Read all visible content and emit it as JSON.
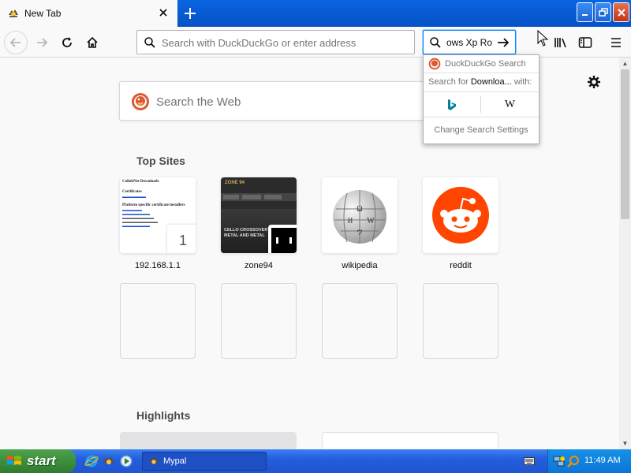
{
  "tab": {
    "title": "New Tab"
  },
  "toolbar": {
    "url_placeholder": "Search with DuckDuckGo or enter address",
    "search_value": "ows Xp Ro"
  },
  "page": {
    "web_search_placeholder": "Search the Web",
    "top_sites_title": "Top Sites",
    "highlights_title": "Highlights",
    "tiles": [
      {
        "label": "192.168.1.1",
        "badge": "1"
      },
      {
        "label": "zone94"
      },
      {
        "label": "wikipedia"
      },
      {
        "label": "reddit"
      }
    ],
    "tile1_thumb": {
      "title": "CollabNet Downloads",
      "lines": [
        "Certificates",
        "Platform specific certificate installers"
      ]
    },
    "tile2_thumb": {
      "banner": "ZONE 94",
      "headline": "CELLO CROSSOVER METAL AND METAL"
    }
  },
  "dropdown": {
    "header": "DuckDuckGo Search",
    "search_for_prefix": "Search for",
    "search_for_query": "Downloa...",
    "search_for_suffix": "with:",
    "wiki_glyph": "W",
    "settings": "Change Search Settings"
  },
  "taskbar": {
    "start_label": "start",
    "task_label": "Mypal",
    "clock": "11:49 AM"
  },
  "colors": {
    "accent": "#0a84ff",
    "ddg_orange": "#de5833",
    "reddit_orange": "#ff4500",
    "bing_teal": "#00809d",
    "xp_blue": "#245edc",
    "xp_green": "#3c8e3c"
  }
}
